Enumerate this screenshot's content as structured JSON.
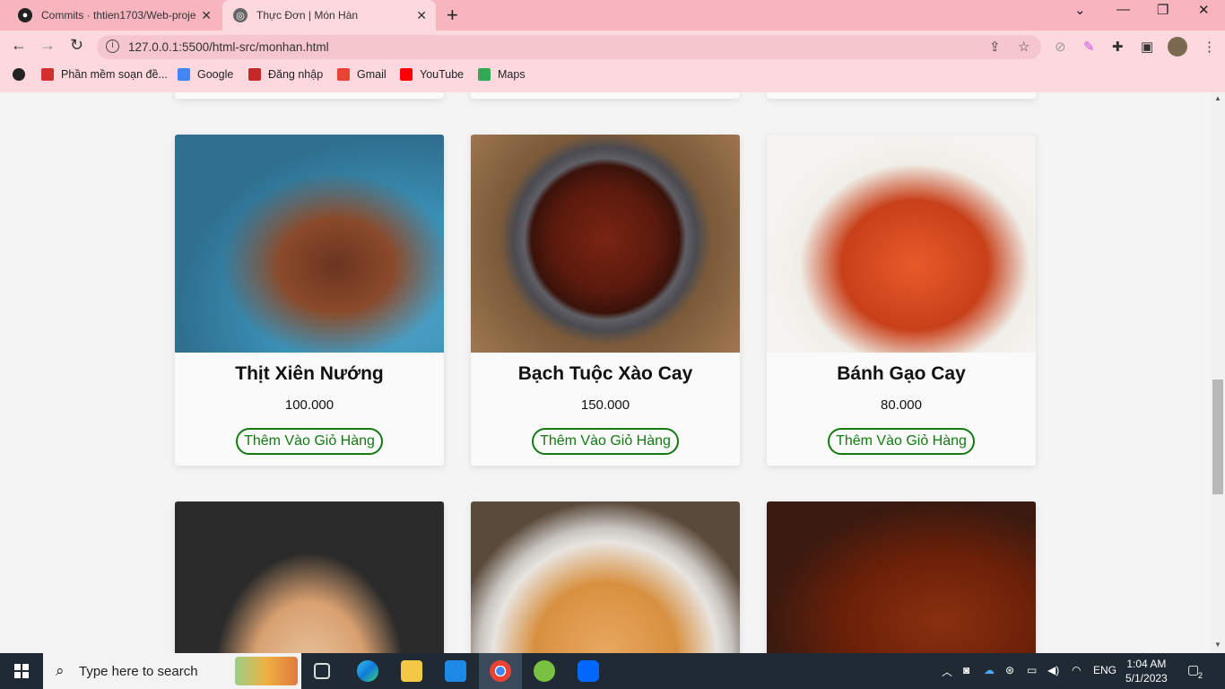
{
  "browser": {
    "tabs": [
      {
        "title": "Commits · thtien1703/Web-proje",
        "favicon": "github-icon"
      },
      {
        "title": "Thực Đơn | Món Hàn",
        "favicon": "globe-icon"
      }
    ],
    "url": "127.0.0.1:5500/html-src/monhan.html",
    "bookmarks": [
      {
        "label": "Phần mềm soạn đề...",
        "icon": "v-logo-icon",
        "color": "#d32f2f"
      },
      {
        "label": "Google",
        "icon": "google-icon",
        "color": "#4285f4"
      },
      {
        "label": "Đăng nhập",
        "icon": "login-icon",
        "color": "#c62828"
      },
      {
        "label": "Gmail",
        "icon": "gmail-icon",
        "color": "#ea4335"
      },
      {
        "label": "YouTube",
        "icon": "youtube-icon",
        "color": "#ff0000"
      },
      {
        "label": "Maps",
        "icon": "maps-icon",
        "color": "#34a853"
      }
    ]
  },
  "menu": {
    "button_label": "Thêm Vào Giỏ Hàng",
    "items": [
      {
        "name": "Thịt Xiên Nướng",
        "price": "100.000"
      },
      {
        "name": "Bạch Tuộc Xào Cay",
        "price": "150.000"
      },
      {
        "name": "Bánh Gạo Cay",
        "price": "80.000"
      }
    ]
  },
  "taskbar": {
    "search_placeholder": "Type here to search",
    "language": "ENG",
    "time": "1:04 AM",
    "date": "5/1/2023",
    "notification_count": "2"
  },
  "colors": {
    "accent_green": "#137a13",
    "tab_pink": "#f8b4bf",
    "toolbar_pink": "#fdd9df"
  }
}
